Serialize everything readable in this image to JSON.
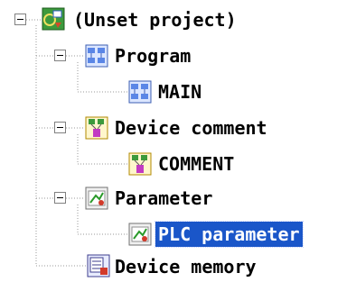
{
  "tree": {
    "root": {
      "label": "(Unset project)",
      "icon": "project-icon"
    },
    "groups": [
      {
        "label": "Program",
        "icon": "program-icon",
        "children": [
          {
            "label": "MAIN",
            "icon": "program-icon"
          }
        ]
      },
      {
        "label": "Device comment",
        "icon": "device-comment-icon",
        "children": [
          {
            "label": "COMMENT",
            "icon": "device-comment-icon"
          }
        ]
      },
      {
        "label": "Parameter",
        "icon": "parameter-icon",
        "children": [
          {
            "label": "PLC parameter",
            "icon": "parameter-icon",
            "selected": true
          }
        ]
      }
    ],
    "device_memory": {
      "label": "Device memory",
      "icon": "device-memory-icon"
    }
  },
  "colors": {
    "selection_bg": "#1a56c9",
    "selection_text": "#ffffff"
  }
}
